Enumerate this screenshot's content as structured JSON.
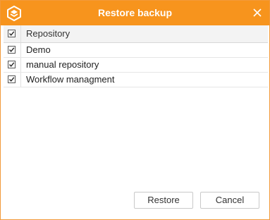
{
  "dialog": {
    "title": "Restore backup"
  },
  "table": {
    "header": {
      "label": "Repository",
      "checked": true
    },
    "rows": [
      {
        "label": "Demo",
        "checked": true
      },
      {
        "label": "manual repository",
        "checked": true
      },
      {
        "label": "Workflow managment",
        "checked": true
      }
    ]
  },
  "buttons": {
    "restore_label": "Restore",
    "cancel_label": "Cancel"
  },
  "colors": {
    "accent": "#f7941d",
    "title_text": "#ffffff"
  },
  "icons": {
    "app": "cube-app-icon",
    "close": "close-icon",
    "check": "checkmark-icon"
  }
}
